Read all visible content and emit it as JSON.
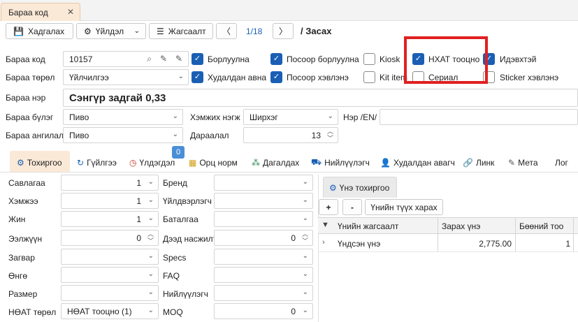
{
  "doc_tab": {
    "label": "Бараа код",
    "close": "✕"
  },
  "toolbar": {
    "save": "Хадгалах",
    "actions": "Үйлдэл",
    "list": "Жагсаалт",
    "prev": "〈",
    "page": "1/18",
    "next": "〉",
    "mode": "/ Засах"
  },
  "form": {
    "code_label": "Бараа код",
    "code_value": "10157",
    "type_label": "Бараа төрөл",
    "type_value": "Үйлчилгээ",
    "name_label": "Бараа нэр",
    "name_value": "Сэнгүр задгай 0,33",
    "group_label": "Бараа бүлэг",
    "group_value": "Пиво",
    "category_label": "Бараа ангилал",
    "category_value": "Пиво",
    "unit_label": "Хэмжих нэгж",
    "unit_value": "Ширхэг",
    "order_label": "Дараалал",
    "order_value": "13",
    "name_en_label": "Нэр /EN/",
    "name_en_value": ""
  },
  "checkboxes": [
    {
      "label": "Борлуулна",
      "checked": true
    },
    {
      "label": "Посоор борлуулна",
      "checked": true
    },
    {
      "label": "Kiosk",
      "checked": false
    },
    {
      "label": "НХАТ тооцно",
      "checked": true
    },
    {
      "label": "Идэвхтэй",
      "checked": true
    },
    {
      "label": "Худалдан авна",
      "checked": true
    },
    {
      "label": "Посоор хэвлэнэ",
      "checked": true
    },
    {
      "label": "Kit item",
      "checked": false
    },
    {
      "label": "Сериал",
      "checked": false
    },
    {
      "label": "Sticker хэвлэнэ",
      "checked": false
    }
  ],
  "tabs": [
    {
      "label": "Тохиргоо",
      "icon": "gear-icon",
      "glyph": "⚙"
    },
    {
      "label": "Гүйлгээ",
      "icon": "history-icon",
      "glyph": "↻"
    },
    {
      "label": "Үлдэгдэл",
      "icon": "clock-icon",
      "glyph": "◷"
    },
    {
      "label": "Орц норм",
      "icon": "grid-icon",
      "glyph": "▦"
    },
    {
      "label": "Дагалдах",
      "icon": "tree-icon",
      "glyph": "⁂"
    },
    {
      "label": "Нийлүүлэгч",
      "icon": "truck-icon",
      "glyph": "⛟"
    },
    {
      "label": "Худалдан авагч",
      "icon": "person-icon",
      "glyph": "👤"
    },
    {
      "label": "Линк",
      "icon": "link-icon",
      "glyph": "🔗"
    },
    {
      "label": "Мета",
      "icon": "edit-doc-icon",
      "glyph": "✎"
    },
    {
      "label": "Лог",
      "icon": "",
      "glyph": ""
    }
  ],
  "badge": "0",
  "left_fields": [
    {
      "label": "Савлагаа",
      "value": "1",
      "type": "num"
    },
    {
      "label": "Хэмжээ",
      "value": "1",
      "type": "num"
    },
    {
      "label": "Жин",
      "value": "1",
      "type": "num"
    },
    {
      "label": "Ээлжүүн",
      "value": "0",
      "type": "spin"
    },
    {
      "label": "Загвар",
      "value": "",
      "type": "select"
    },
    {
      "label": "Өнгө",
      "value": "",
      "type": "select"
    },
    {
      "label": "Размер",
      "value": "",
      "type": "select"
    },
    {
      "label": "НӨАТ төрөл",
      "value": "НӨАТ тооцно (1)",
      "type": "select"
    }
  ],
  "mid_fields": [
    {
      "label": "Бренд",
      "value": "",
      "type": "select"
    },
    {
      "label": "Үйлдвэрлэгч",
      "value": "",
      "type": "select"
    },
    {
      "label": "Баталгаа",
      "value": "",
      "type": "select"
    },
    {
      "label": "Дээд насжилт",
      "value": "0",
      "type": "spin"
    },
    {
      "label": "Specs",
      "value": "",
      "type": "select"
    },
    {
      "label": "FAQ",
      "value": "",
      "type": "select"
    },
    {
      "label": "Нийлүүлэгч",
      "value": "",
      "type": "select"
    },
    {
      "label": "MOQ",
      "value": "0",
      "type": "select"
    }
  ],
  "price_panel": {
    "tab_label": "Үнэ тохиргоо",
    "add": "+",
    "remove": "-",
    "history": "Үнийн түүх харах",
    "columns": [
      "Үнийн жагсаалт",
      "Зарах үнэ",
      "Бөөний тоо"
    ],
    "rows": [
      {
        "list": "Үндсэн үнэ",
        "price": "2,775.00",
        "bulk": "1"
      }
    ]
  },
  "colors": {
    "highlight": "#e02020",
    "accent": "#1a5fb4",
    "tab_active": "#fbe9d7"
  }
}
